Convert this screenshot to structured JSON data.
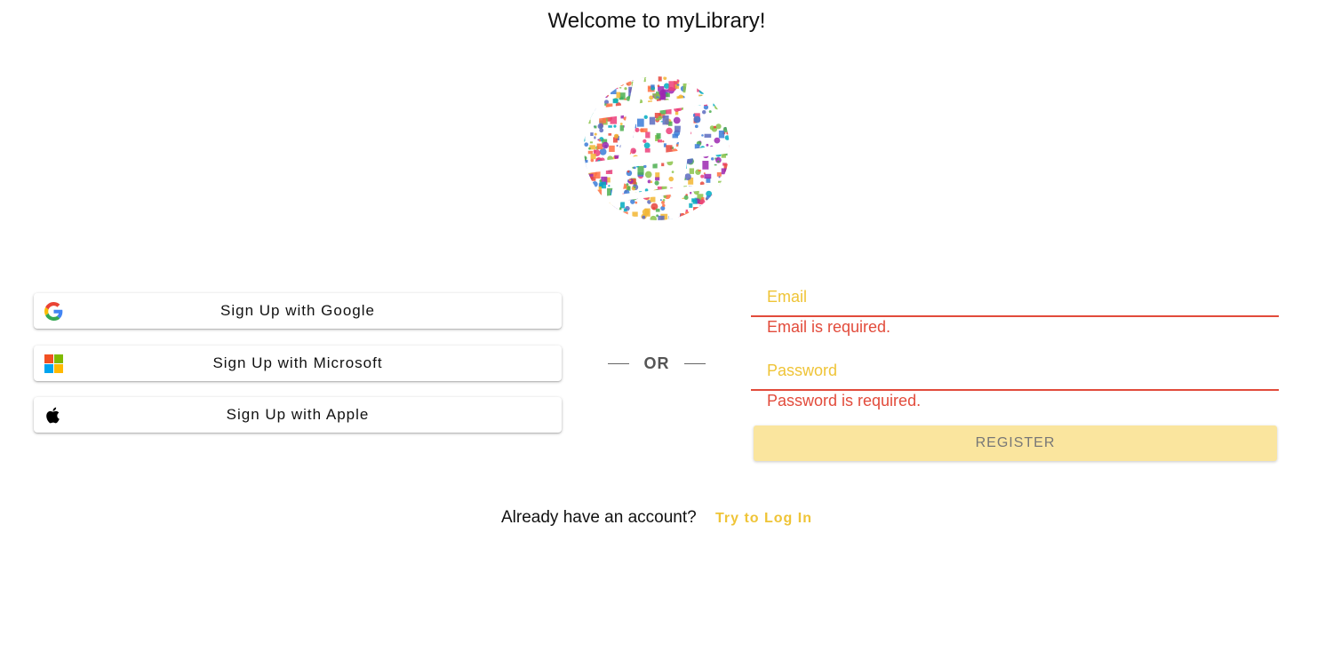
{
  "page": {
    "title": "Welcome to myLibrary!"
  },
  "logo": {
    "icon": "globe-collage-logo"
  },
  "social": {
    "google_label": "Sign Up with Google",
    "microsoft_label": "Sign Up with Microsoft",
    "apple_label": "Sign Up with Apple"
  },
  "separator": {
    "label": "OR"
  },
  "form": {
    "email_placeholder": "Email",
    "email_value": "",
    "email_error": "Email is required.",
    "password_placeholder": "Password",
    "password_value": "",
    "password_error": "Password is required.",
    "register_label": "REGISTER"
  },
  "footer": {
    "question": "Already have an account?",
    "login_link": "Try to Log In"
  },
  "colors": {
    "accent": "#efc437",
    "error": "#e24b3b",
    "register_bg": "#fae59e"
  }
}
